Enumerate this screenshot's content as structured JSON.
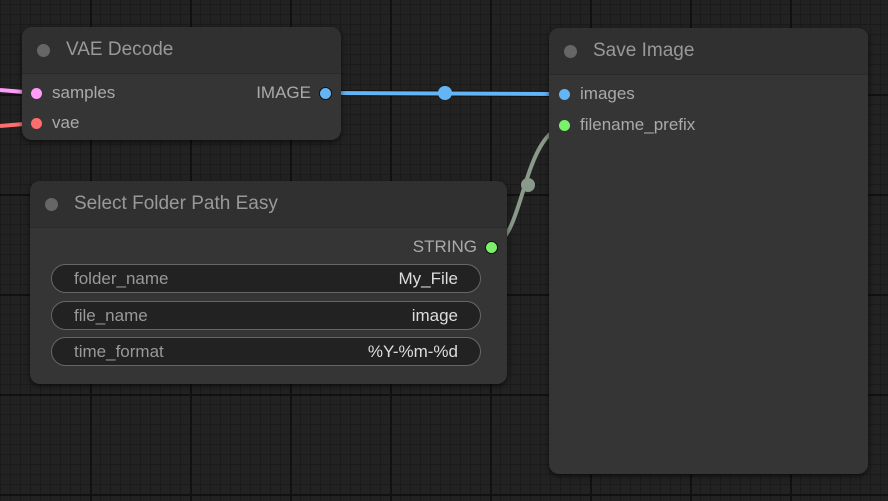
{
  "nodes": {
    "vae_decode": {
      "title": "VAE Decode",
      "inputs": [
        "samples",
        "vae"
      ],
      "output": "IMAGE"
    },
    "select_folder": {
      "title": "Select Folder Path Easy",
      "output": "STRING",
      "widgets": [
        {
          "label": "folder_name",
          "value": "My_File"
        },
        {
          "label": "file_name",
          "value": "image"
        },
        {
          "label": "time_format",
          "value": "%Y-%m-%d"
        }
      ]
    },
    "save_image": {
      "title": "Save Image",
      "inputs": [
        "images",
        "filename_prefix"
      ]
    }
  },
  "colors": {
    "latent": "#ff9cf9",
    "vae": "#ff6e6e",
    "image": "#64b5f6",
    "string": "#7bf06b",
    "string_link": "#8a9a8a"
  }
}
